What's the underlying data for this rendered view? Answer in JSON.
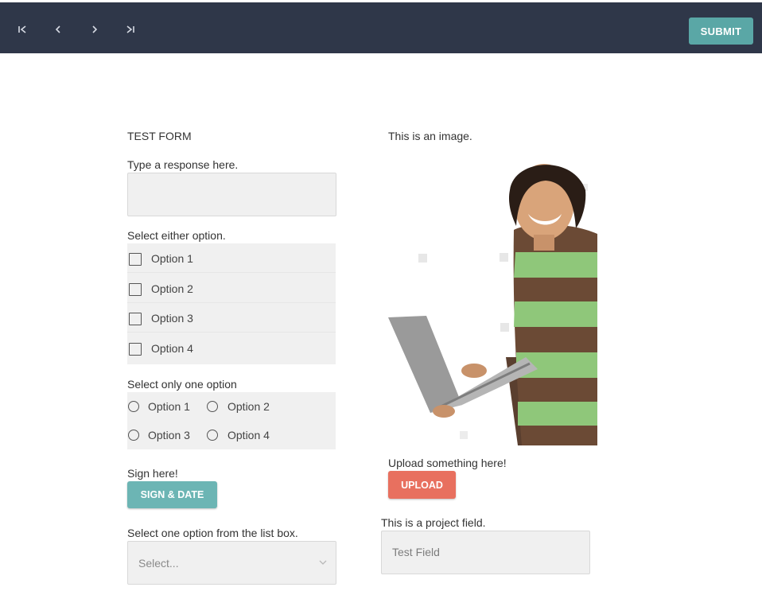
{
  "toolbar": {
    "first_icon": "first-page-icon",
    "prev_icon": "chevron-left-icon",
    "next_icon": "chevron-right-icon",
    "last_icon": "last-page-icon",
    "submit_label": "SUBMIT",
    "submit_color": "#5aa7a6",
    "bar_color": "#2f3749"
  },
  "form": {
    "title": "TEST FORM",
    "response_label": "Type a response here.",
    "response_value": "",
    "checkbox_label": "Select either option.",
    "checkboxes": [
      {
        "label": "Option 1",
        "checked": false
      },
      {
        "label": "Option 2",
        "checked": false
      },
      {
        "label": "Option 3",
        "checked": false
      },
      {
        "label": "Option 4",
        "checked": false
      }
    ],
    "radio_label": "Select only one option",
    "radios": [
      {
        "label": "Option 1",
        "selected": false
      },
      {
        "label": "Option 2",
        "selected": false
      },
      {
        "label": "Option 3",
        "selected": false
      },
      {
        "label": "Option 4",
        "selected": false
      }
    ],
    "sign_label": "Sign here!",
    "sign_button": "SIGN & DATE",
    "sign_color": "#6cb5b4",
    "listbox_label": "Select one option from the list box.",
    "listbox_value": "Select...",
    "image_label": "This is an image.",
    "upload_label": "Upload something here!",
    "upload_button": "UPLOAD",
    "upload_color": "#e8705f",
    "project_label": "This is a project field.",
    "project_value": "Test Field"
  }
}
